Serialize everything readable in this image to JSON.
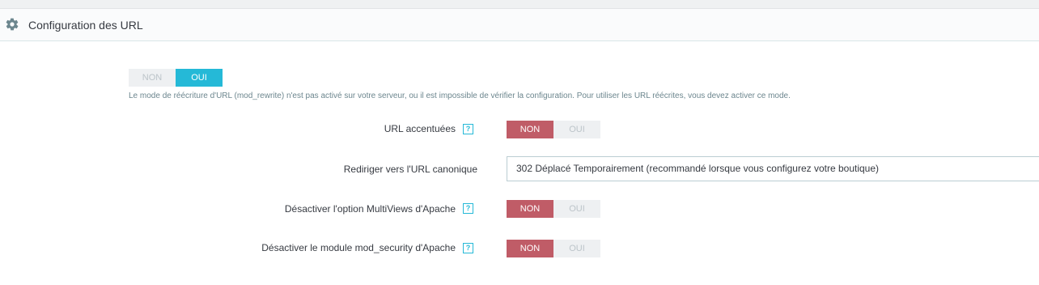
{
  "panel": {
    "icon": "gear-icon",
    "title": "Configuration des URL"
  },
  "rewrite": {
    "off_label": "NON",
    "on_label": "OUI",
    "selected": "OUI",
    "help_text": "Le mode de réécriture d'URL (mod_rewrite) n'est pas activé sur votre serveur, ou il est impossible de vérifier la configuration. Pour utiliser les URL réécrites, vous devez activer ce mode."
  },
  "accented_urls": {
    "label": "URL accentuées",
    "help_icon": "?",
    "off_label": "NON",
    "on_label": "OUI",
    "selected": "NON"
  },
  "canonical_redirect": {
    "label": "Rediriger vers l'URL canonique",
    "value": "302 Déplacé Temporairement (recommandé lorsque vous configurez votre boutique)"
  },
  "multiviews": {
    "label": "Désactiver l'option MultiViews d'Apache",
    "help_icon": "?",
    "off_label": "NON",
    "on_label": "OUI",
    "selected": "NON"
  },
  "mod_security": {
    "label": "Désactiver le module mod_security d'Apache",
    "help_icon": "?",
    "off_label": "NON",
    "on_label": "OUI",
    "selected": "NON"
  },
  "colors": {
    "accent_blue": "#25b9d7",
    "accent_red": "#c05c67",
    "inactive_bg": "#eef0f2"
  }
}
